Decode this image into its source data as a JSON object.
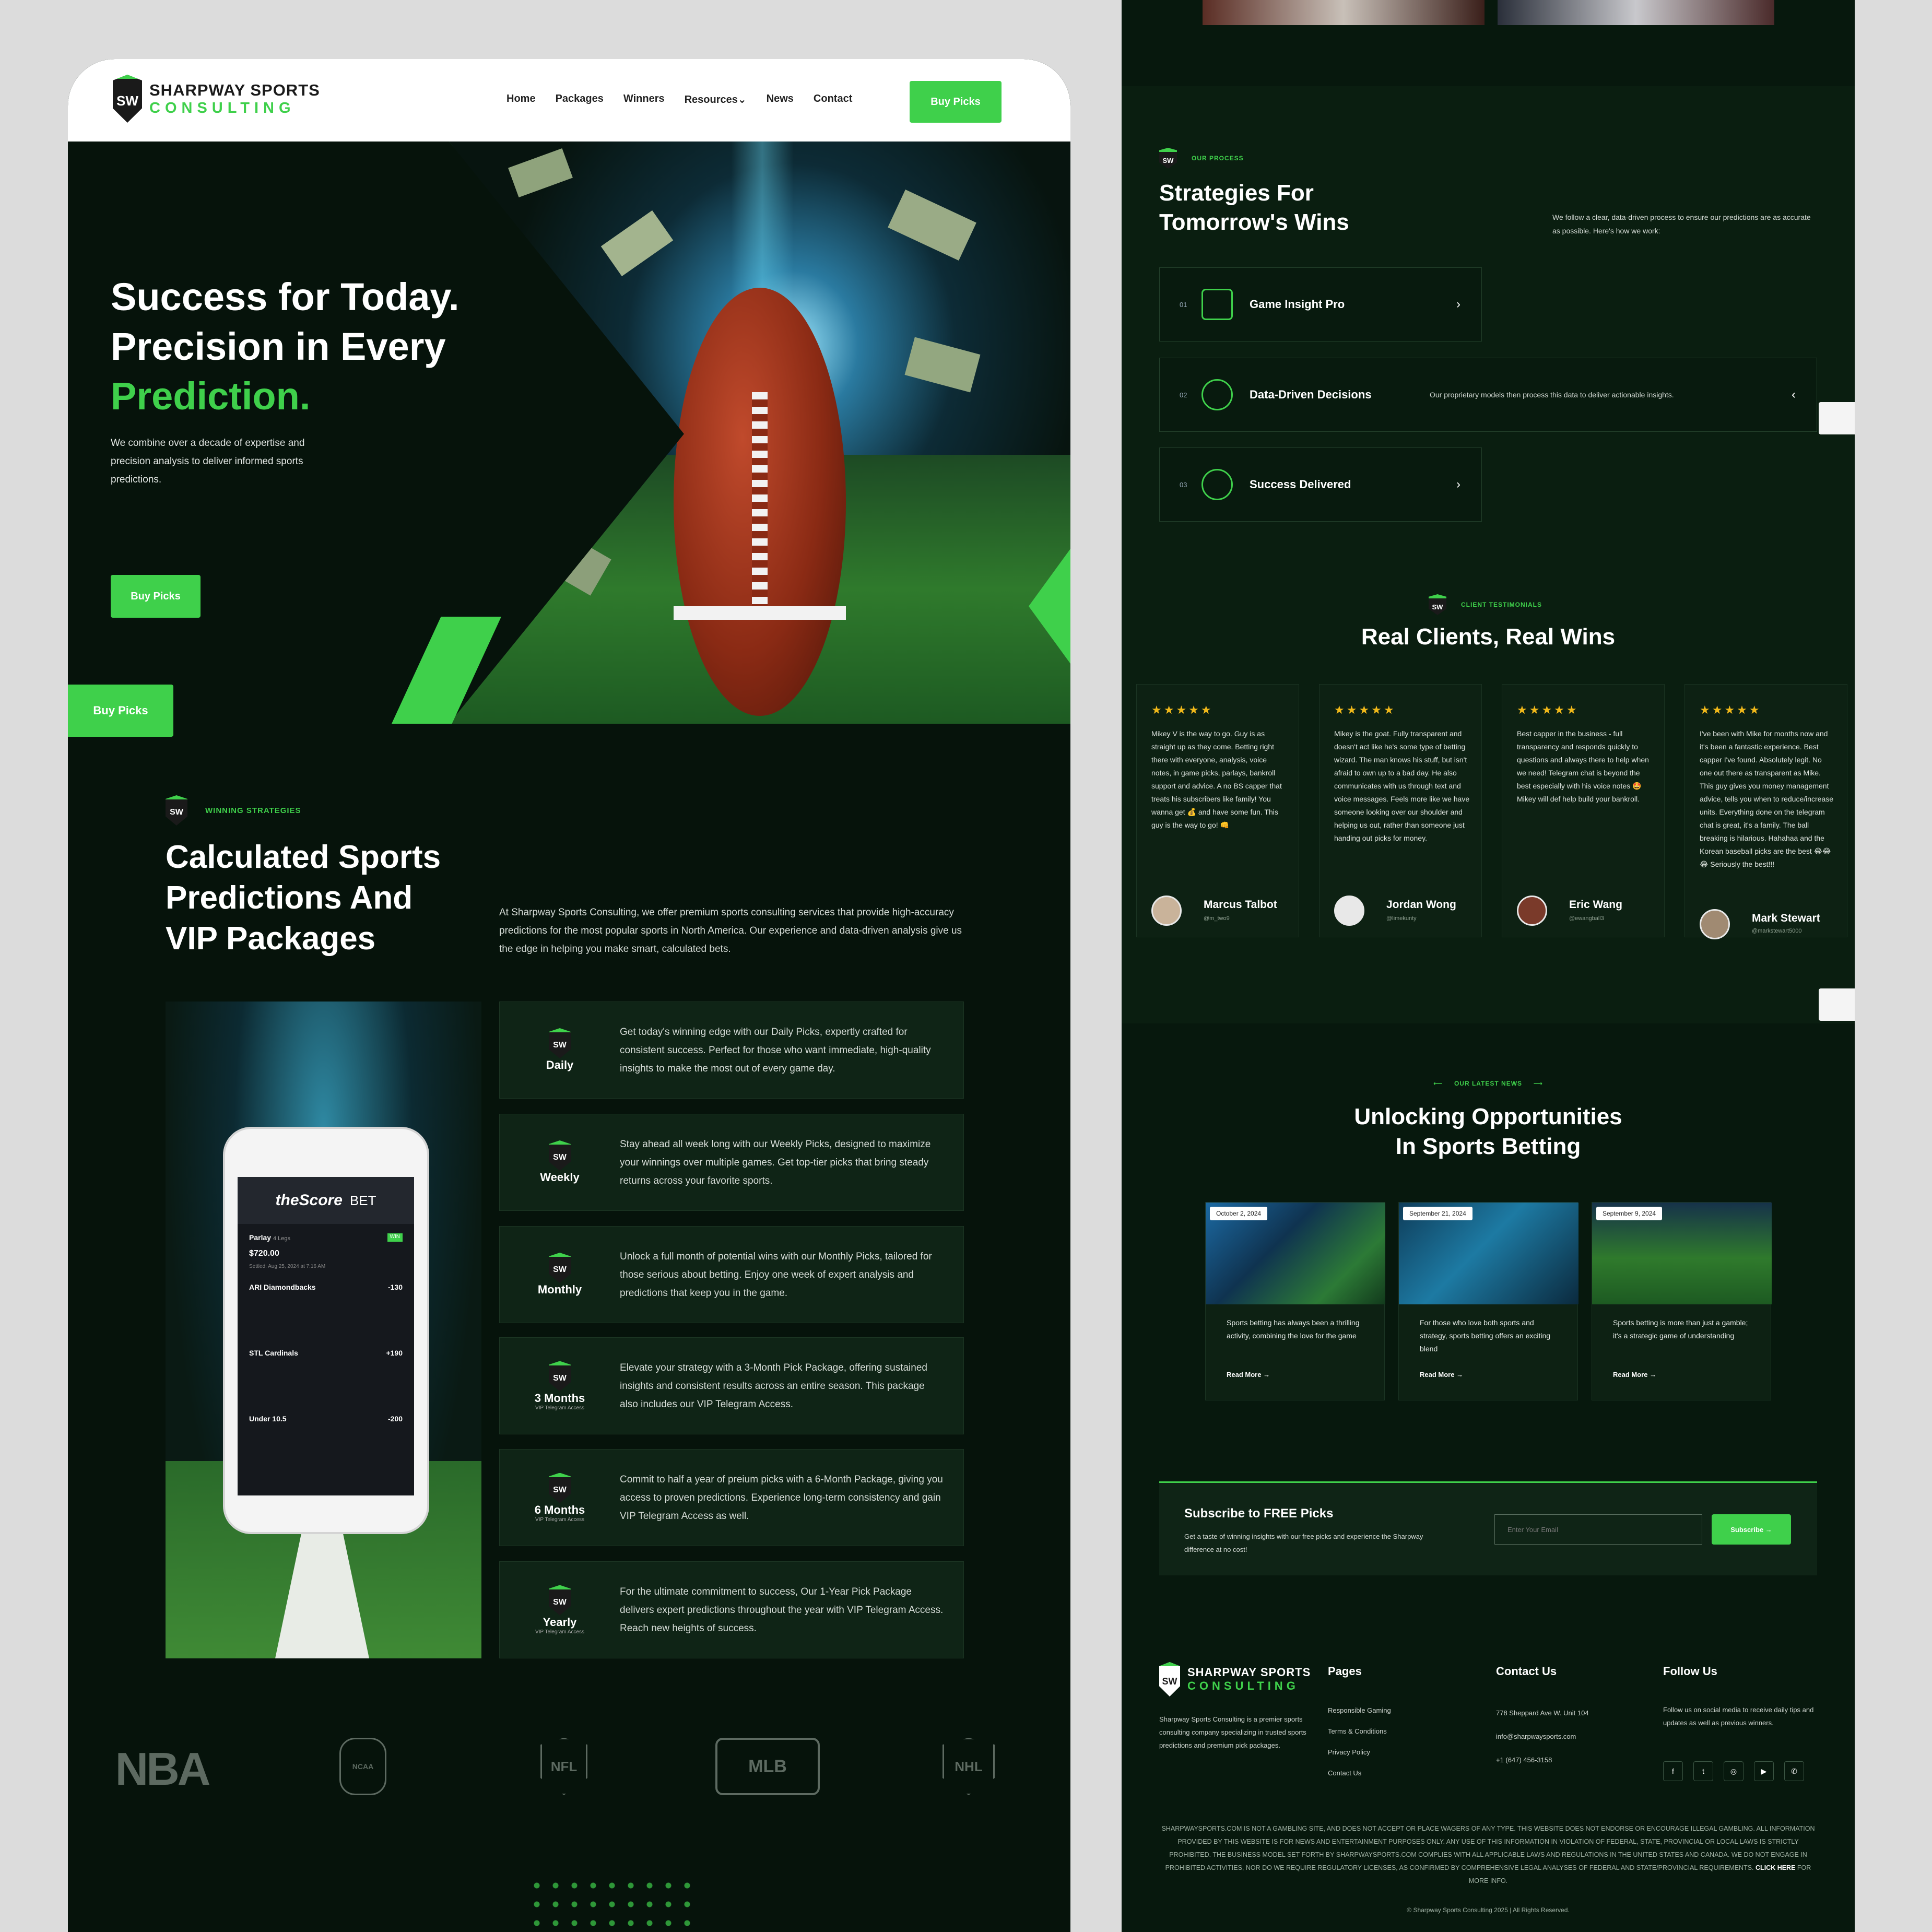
{
  "brand": {
    "name_top": "SHARPWAY SPORTS",
    "name_bottom": "CONSULTING",
    "mark": "SW"
  },
  "nav": {
    "items": [
      "Home",
      "Packages",
      "Winners",
      "Resources",
      "News",
      "Contact"
    ],
    "resources_chevron": "⌄",
    "cta": "Buy Picks"
  },
  "hero": {
    "line1": "Success for Today.",
    "line2": "Precision in Every",
    "line3": "Prediction.",
    "desc": "We combine over a decade of expertise and precision analysis to deliver informed sports predictions.",
    "cta": "Buy Picks",
    "side_cta": "Buy Picks"
  },
  "strategies": {
    "label": "Winning Strategies",
    "title1": "Calculated Sports",
    "title2": "Predictions And",
    "title3": "VIP Packages",
    "desc": "At Sharpway Sports Consulting, we offer premium sports consulting services that provide high-accuracy predictions for the most popular sports in North America. Our experience and data-driven analysis give us the edge in helping you make smart, calculated bets."
  },
  "phone": {
    "brand": "theScore",
    "bet": "BET",
    "parlay": "Parlay",
    "legs": "4 Legs",
    "stake": "$720.00",
    "status": "Settled: Aug 25, 2024 at 7:16 AM",
    "win": "WIN",
    "b1_team": "ARI Diamondbacks",
    "b1_odds": "-130",
    "b2_team": "STL Cardinals",
    "b2_odds": "+190",
    "b3_team": "Under 10.5",
    "b3_odds": "-200"
  },
  "packages": [
    {
      "name": "Daily",
      "sub": "",
      "desc": "Get today's winning edge with our Daily Picks, expertly crafted for consistent success. Perfect for those who want immediate, high-quality insights to make the most out of every game day."
    },
    {
      "name": "Weekly",
      "sub": "",
      "desc": "Stay ahead all week long with our Weekly Picks, designed to maximize your winnings over multiple games. Get top-tier picks that bring steady returns across your favorite sports."
    },
    {
      "name": "Monthly",
      "sub": "",
      "desc": "Unlock a full month of potential wins with our Monthly Picks, tailored for those serious about betting. Enjoy one week of expert analysis and predictions that keep you in the game."
    },
    {
      "name": "3 Months",
      "sub": "VIP Telegram Access",
      "desc": "Elevate your strategy with a 3-Month Pick Package, offering sustained insights and consistent results across an entire season. This package also includes our VIP Telegram Access."
    },
    {
      "name": "6 Months",
      "sub": "VIP Telegram Access",
      "desc": "Commit to half a year of preium picks with a 6-Month Package, giving you access to proven predictions. Experience long-term consistency and gain VIP Telegram Access as well."
    },
    {
      "name": "Yearly",
      "sub": "VIP Telegram Access",
      "desc": "For the ultimate commitment to success, Our 1-Year Pick Package delivers expert predictions throughout the year with VIP Telegram Access. Reach new heights of success."
    }
  ],
  "leagues": [
    "NBA",
    "NCAA",
    "NFL",
    "MLB",
    "NHL"
  ],
  "process": {
    "label": "Our Process",
    "title1": "Strategies For",
    "title2": "Tomorrow's Wins",
    "desc": "We follow a clear, data-driven process to ensure our predictions are as accurate as possible. Here's how we work:",
    "steps": [
      {
        "num": "01",
        "title": "Game Insight Pro",
        "desc": ""
      },
      {
        "num": "02",
        "title": "Data-Driven Decisions",
        "desc": "Our proprietary models then process this data to deliver actionable insights."
      },
      {
        "num": "03",
        "title": "Success Delivered",
        "desc": ""
      }
    ]
  },
  "testimonials": {
    "label": "Client Testimonials",
    "title": "Real Clients, Real Wins",
    "stars": "★★★★★",
    "items": [
      {
        "text": "Mikey V is the way to go. Guy is as straight up as they come. Betting right there with everyone, analysis, voice notes, in game picks, parlays, bankroll support and advice. A no BS capper that treats his subscribers like family! You wanna get 💰 and have some fun. This guy is the way to go! 👊",
        "name": "Marcus Talbot",
        "handle": "@m_two9"
      },
      {
        "text": "Mikey is the goat. Fully transparent and doesn't act like he's some type of betting wizard. The man knows his stuff, but isn't afraid to own up to a bad day. He also communicates with us through text and voice messages. Feels more like we have someone looking over our shoulder and helping us out, rather than someone just handing out picks for money.",
        "name": "Jordan Wong",
        "handle": "@limekunty"
      },
      {
        "text": "Best capper in the business - full transparency and responds quickly to questions and always there to help when we need! Telegram chat is beyond the best especially with his voice notes 🤩 Mikey will def help build your bankroll.",
        "name": "Eric Wang",
        "handle": "@ewangball3"
      },
      {
        "text": "I've been with Mike for months now and it's been a fantastic experience. Best capper I've found. Absolutely legit. No one out there as transparent as Mike. This guy gives you money management advice, tells you when to reduce/increase units. Everything done on the telegram chat is great, it's a family. The ball breaking is hilarious. Hahahaa and the Korean baseball picks are the best 😂😂😂 Seriously the best!!!",
        "name": "Mark Stewart",
        "handle": "@markstewart5000"
      }
    ]
  },
  "news": {
    "label": "Our Latest News",
    "title1": "Unlocking Opportunities",
    "title2": "In Sports Betting",
    "read_more": "Read More",
    "items": [
      {
        "date": "October 2, 2024",
        "text": "Sports betting has always been a thrilling activity, combining the love for the game"
      },
      {
        "date": "September 21, 2024",
        "text": "For those who love both sports and strategy, sports betting offers an exciting blend"
      },
      {
        "date": "September 9, 2024",
        "text": "Sports betting is more than just a gamble; it's a strategic game of understanding"
      }
    ]
  },
  "subscribe": {
    "title": "Subscribe to FREE Picks",
    "desc": "Get a taste of winning insights with our free picks and experience the Sharpway difference at no cost!",
    "placeholder": "Enter Your Email",
    "button": "Subscribe →"
  },
  "footer": {
    "about": "Sharpway Sports Consulting is a premier sports consulting company specializing in trusted sports predictions and premium pick packages.",
    "pages_title": "Pages",
    "pages": [
      "Responsible Gaming",
      "Terms & Conditions",
      "Privacy Policy",
      "Contact Us"
    ],
    "contact_title": "Contact Us",
    "address": "778 Sheppard Ave W. Unit 104",
    "email": "info@sharpwaysports.com",
    "phone": "+1 (647) 456-3158",
    "follow_title": "Follow Us",
    "follow_desc": "Follow us on social media to receive daily tips and updates as well as previous winners.",
    "socials": [
      "f",
      "t",
      "◎",
      "▶",
      "✆"
    ],
    "disclaimer": "SHARPWAYSPORTS.COM IS NOT A GAMBLING SITE, AND DOES NOT ACCEPT OR PLACE WAGERS OF ANY TYPE. THIS WEBSITE DOES NOT ENDORSE OR ENCOURAGE ILLEGAL GAMBLING. ALL INFORMATION PROVIDED BY THIS WEBSITE IS FOR NEWS AND ENTERTAINMENT PURPOSES ONLY. ANY USE OF THIS INFORMATION IN VIOLATION OF FEDERAL, STATE, PROVINCIAL OR LOCAL LAWS IS STRICTLY PROHIBITED. THE BUSINESS MODEL SET FORTH BY SHARPWAYSPORTS.COM COMPLIES WITH ALL APPLICABLE LAWS AND REGULATIONS IN THE UNITED STATES AND CANADA. WE DO NOT ENGAGE IN PROHIBITED ACTIVITIES, NOR DO WE REQUIRE REGULATORY LICENSES, AS CONFIRMED BY COMPREHENSIVE LEGAL ANALYSES OF FEDERAL AND STATE/PROVINCIAL REQUIREMENTS.",
    "click_here": "CLICK HERE",
    "more_info": "FOR MORE INFO.",
    "copyright": "© Sharpway Sports Consulting 2025 | All Rights Reserved."
  },
  "colors": {
    "accent": "#3fd04b",
    "bg_dark": "#06130b",
    "star": "#f0b81a"
  }
}
